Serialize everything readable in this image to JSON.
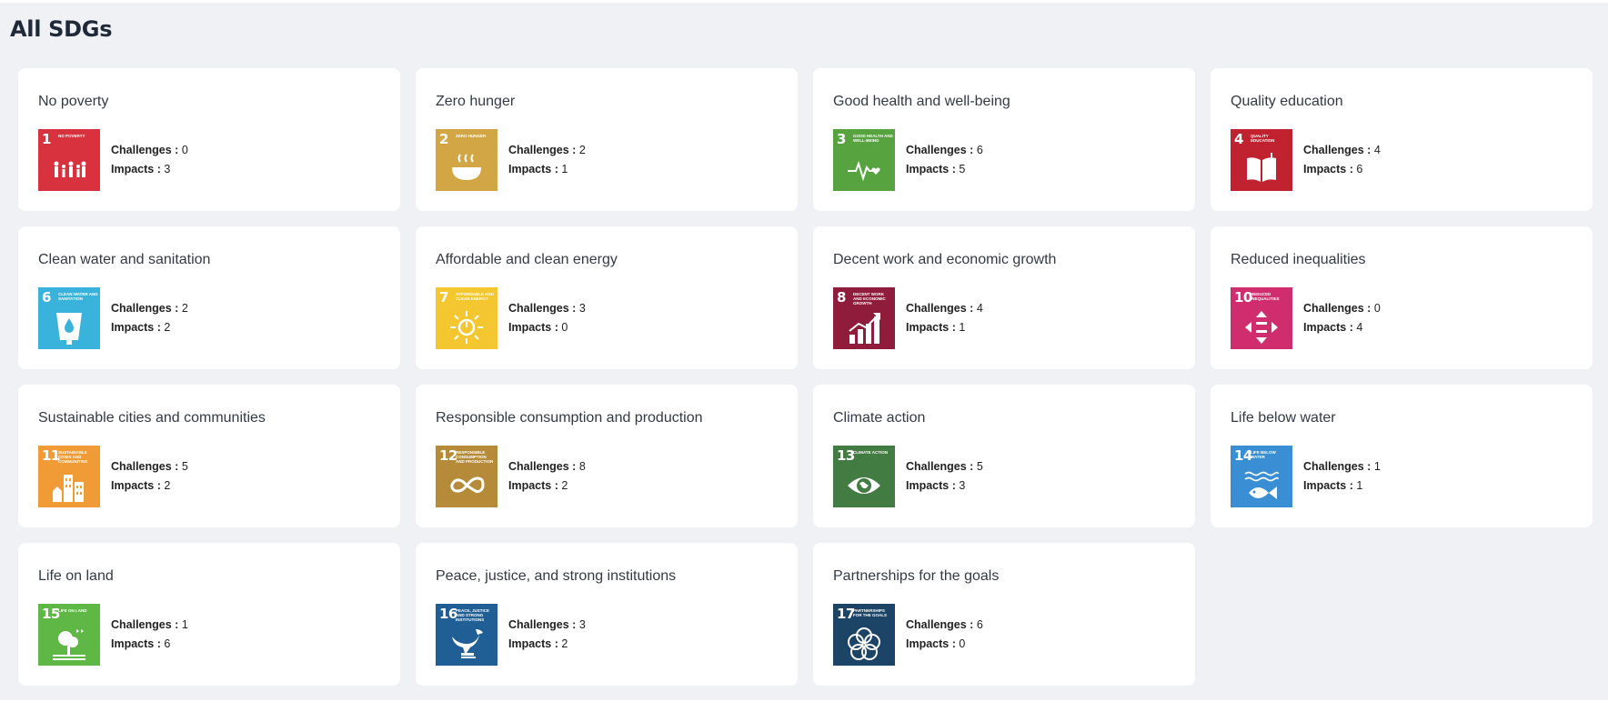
{
  "page": {
    "title": "All SDGs"
  },
  "labels": {
    "challenges": "Challenges :",
    "impacts": "Impacts :"
  },
  "sdgs": [
    {
      "title": "No poverty",
      "tile_number": "1",
      "tile_label": "No poverty",
      "color": "#d9323f",
      "icon": "family-icon",
      "challenges": 0,
      "impacts": 3
    },
    {
      "title": "Zero hunger",
      "tile_number": "2",
      "tile_label": "Zero hunger",
      "color": "#d3a645",
      "icon": "bowl-icon",
      "challenges": 2,
      "impacts": 1
    },
    {
      "title": "Good health and well-being",
      "tile_number": "3",
      "tile_label": "Good health and well-being",
      "color": "#57a33f",
      "icon": "heartbeat-icon",
      "challenges": 6,
      "impacts": 5
    },
    {
      "title": "Quality education",
      "tile_number": "4",
      "tile_label": "Quality education",
      "color": "#c1222f",
      "icon": "book-icon",
      "challenges": 4,
      "impacts": 6
    },
    {
      "title": "Clean water and sanitation",
      "tile_number": "6",
      "tile_label": "Clean water and sanitation",
      "color": "#3ab3dc",
      "icon": "water-glass-icon",
      "challenges": 2,
      "impacts": 2
    },
    {
      "title": "Affordable and clean energy",
      "tile_number": "7",
      "tile_label": "Affordable and clean energy",
      "color": "#f4c630",
      "icon": "sun-power-icon",
      "challenges": 3,
      "impacts": 0
    },
    {
      "title": "Decent work and economic growth",
      "tile_number": "8",
      "tile_label": "Decent work and economic growth",
      "color": "#8f1c3a",
      "icon": "growth-chart-icon",
      "challenges": 4,
      "impacts": 1
    },
    {
      "title": "Reduced inequalities",
      "tile_number": "10",
      "tile_label": "Reduced inequalities",
      "color": "#d02d6e",
      "icon": "equality-arrows-icon",
      "challenges": 0,
      "impacts": 4
    },
    {
      "title": "Sustainable cities and communities",
      "tile_number": "11",
      "tile_label": "Sustainable cities and communities",
      "color": "#f09b36",
      "icon": "city-icon",
      "challenges": 5,
      "impacts": 2
    },
    {
      "title": "Responsible consumption and production",
      "tile_number": "12",
      "tile_label": "Responsible consumption and production",
      "color": "#b58b39",
      "icon": "infinity-icon",
      "challenges": 8,
      "impacts": 2
    },
    {
      "title": "Climate action",
      "tile_number": "13",
      "tile_label": "Climate action",
      "color": "#437c42",
      "icon": "eye-globe-icon",
      "challenges": 5,
      "impacts": 3
    },
    {
      "title": "Life below water",
      "tile_number": "14",
      "tile_label": "Life below water",
      "color": "#3a8ed3",
      "icon": "fish-icon",
      "challenges": 1,
      "impacts": 1
    },
    {
      "title": "Life on land",
      "tile_number": "15",
      "tile_label": "Life on land",
      "color": "#5fb746",
      "icon": "tree-icon",
      "challenges": 1,
      "impacts": 6
    },
    {
      "title": "Peace, justice, and strong institutions",
      "tile_number": "16",
      "tile_label": "Peace, justice and strong institutions",
      "color": "#1f5f95",
      "icon": "dove-icon",
      "challenges": 3,
      "impacts": 2
    },
    {
      "title": "Partnerships for the goals",
      "tile_number": "17",
      "tile_label": "Partnerships for the goals",
      "color": "#1b4466",
      "icon": "rings-icon",
      "challenges": 6,
      "impacts": 0
    }
  ]
}
